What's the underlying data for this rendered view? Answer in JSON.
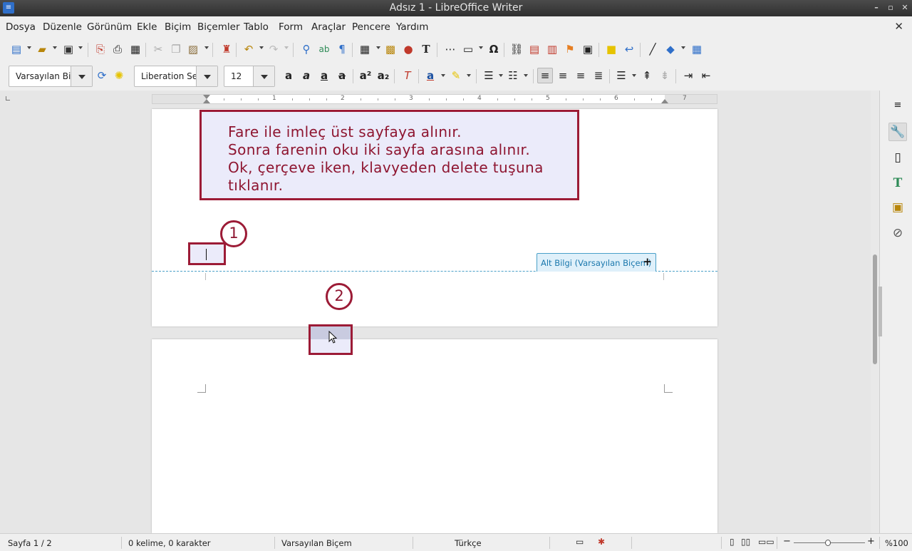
{
  "window": {
    "title": "Adsız 1 - LibreOffice Writer"
  },
  "menu": [
    "Dosya",
    "Düzenle",
    "Görünüm",
    "Ekle",
    "Biçim",
    "Biçemler",
    "Tablo",
    "Form",
    "Araçlar",
    "Pencere",
    "Yardım"
  ],
  "format": {
    "style": "Varsayılan Biç",
    "font": "Liberation Se",
    "size": "12"
  },
  "ruler": {
    "numbers": [
      "1",
      "2",
      "3",
      "4",
      "5",
      "6",
      "7"
    ]
  },
  "callout": {
    "lines": [
      "Fare ile imleç üst sayfaya alınır.",
      "Sonra farenin oku iki sayfa arasına alınır.",
      "Ok, çerçeve iken, klavyeden delete tuşuna",
      "tıklanır."
    ]
  },
  "markers": {
    "one": "1",
    "two": "2"
  },
  "footer_tab": {
    "label": "Alt Bilgi (Varsayılan Biçem)",
    "plus": "+"
  },
  "status": {
    "page": "Sayfa 1 / 2",
    "words": "0 kelime, 0 karakter",
    "page_style": "Varsayılan Biçem",
    "language": "Türkçe",
    "zoom": "%100",
    "zoom_level": 1.0
  },
  "colors": {
    "accent": "#9c1b36",
    "callout_bg": "#ebebfa",
    "footer_blue": "#4aa0c8"
  },
  "icons": {
    "toolbar1": [
      "new-document-icon",
      "open-icon",
      "save-icon",
      "export-pdf-icon",
      "print-icon",
      "print-preview-icon",
      "cut-icon",
      "copy-icon",
      "paste-icon",
      "clone-formatting-icon",
      "undo-icon",
      "redo-icon",
      "find-replace-icon",
      "spelling-icon",
      "formatting-marks-icon",
      "table-icon",
      "image-icon",
      "chart-icon",
      "text-box-icon",
      "page-break-icon",
      "field-icon",
      "special-character-icon",
      "hyperlink-icon",
      "footnote-icon",
      "endnote-icon",
      "bookmark-icon",
      "cross-reference-icon",
      "comment-icon",
      "track-changes-icon",
      "line-icon",
      "basic-shapes-icon",
      "draw-functions-icon"
    ],
    "sidebar": [
      "sidebar-menu-icon",
      "properties-icon",
      "page-icon",
      "styles-icon",
      "gallery-icon",
      "navigator-icon"
    ]
  }
}
